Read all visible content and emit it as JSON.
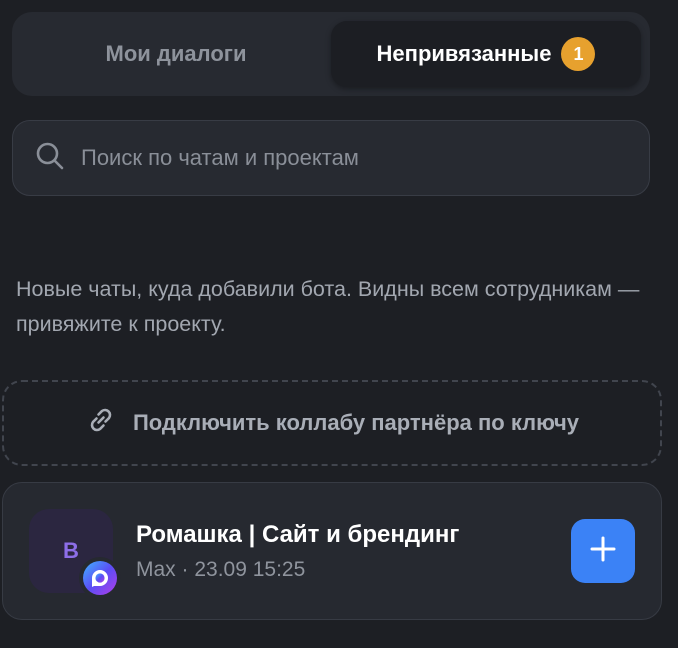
{
  "tabs": {
    "my_dialogs_label": "Мои диалоги",
    "unlinked_label": "Непривязанные",
    "unlinked_count": "1"
  },
  "search": {
    "placeholder": "Поиск по чатам и проектам",
    "value": ""
  },
  "hint": {
    "text": "Новые чаты, куда добавили бота. Видны всем сотрудникам — привяжите к проекту."
  },
  "connect": {
    "label": "Подключить коллабу партнёра по ключу",
    "icon": "link-icon"
  },
  "chat": {
    "avatar_letter": "B",
    "title": "Ромашка | Сайт и брендинг",
    "meta": "Max · 23.09 15:25",
    "app_icon": "max-app-icon",
    "add_icon": "plus-icon"
  },
  "colors": {
    "accent": "#3b82f6",
    "badge": "#e7a12e",
    "avatar_bg": "#2b2640",
    "background": "#1d1f24"
  }
}
